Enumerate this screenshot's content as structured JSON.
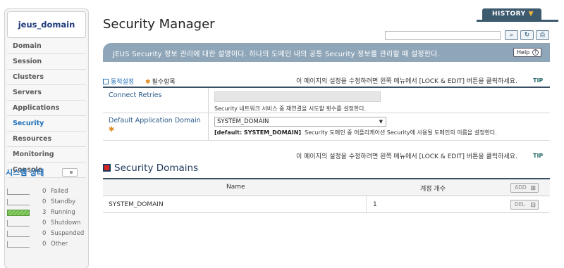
{
  "sidebar": {
    "domain": "jeus_domain",
    "items": [
      {
        "label": "Domain"
      },
      {
        "label": "Session"
      },
      {
        "label": "Clusters"
      },
      {
        "label": "Servers"
      },
      {
        "label": "Applications"
      },
      {
        "label": "Security"
      },
      {
        "label": "Resources"
      },
      {
        "label": "Monitoring"
      },
      {
        "label": "Console"
      }
    ],
    "status_title": "시스템 상태",
    "status": [
      {
        "count": "0",
        "label": "Failed",
        "fill": 0
      },
      {
        "count": "0",
        "label": "Standby",
        "fill": 0
      },
      {
        "count": "3",
        "label": "Running",
        "fill": 1
      },
      {
        "count": "0",
        "label": "Shutdown",
        "fill": 0
      },
      {
        "count": "0",
        "label": "Suspended",
        "fill": 0
      },
      {
        "count": "0",
        "label": "Other",
        "fill": 0
      }
    ]
  },
  "header": {
    "title": "Security Manager",
    "history": "HISTORY",
    "banner": "JEUS Security 정보 관리에 대한 설명이다. 하나의 도메인 내의 공통 Security 정보를 관리할 때 설정한다.",
    "help": "Help"
  },
  "legend": {
    "dynamic": "동적설정",
    "required": "필수항목"
  },
  "lock_message": "이 페이지의 설정을 수정하려면 왼쪽 메뉴에서 [LOCK & EDIT] 버튼을 클릭하세요.",
  "tip": "TIP",
  "settings": {
    "connect_retries": {
      "label": "Connect Retries",
      "value": "",
      "desc": "Security 네트워크 서비스 중 재연결을 시도할 횟수를 설정한다."
    },
    "default_app_domain": {
      "label": "Default Application Domain",
      "value": "SYSTEM_DOMAIN",
      "default": "[default: SYSTEM_DOMAIN]",
      "desc": "Security 도메인 중 어플리케이션 Security에 사용될 도메인의 이름을 설정한다."
    }
  },
  "domains": {
    "title": "Security Domains",
    "col_name": "Name",
    "col_count": "계정 개수",
    "add": "ADD",
    "del": "DEL",
    "rows": [
      {
        "name": "SYSTEM_DOMAIN",
        "count": "1"
      }
    ]
  },
  "colors": {
    "accent": "#1c6db8",
    "banner": "#8fa6b9",
    "header_dark": "#3d5a6e",
    "running": "#6cb84a"
  }
}
